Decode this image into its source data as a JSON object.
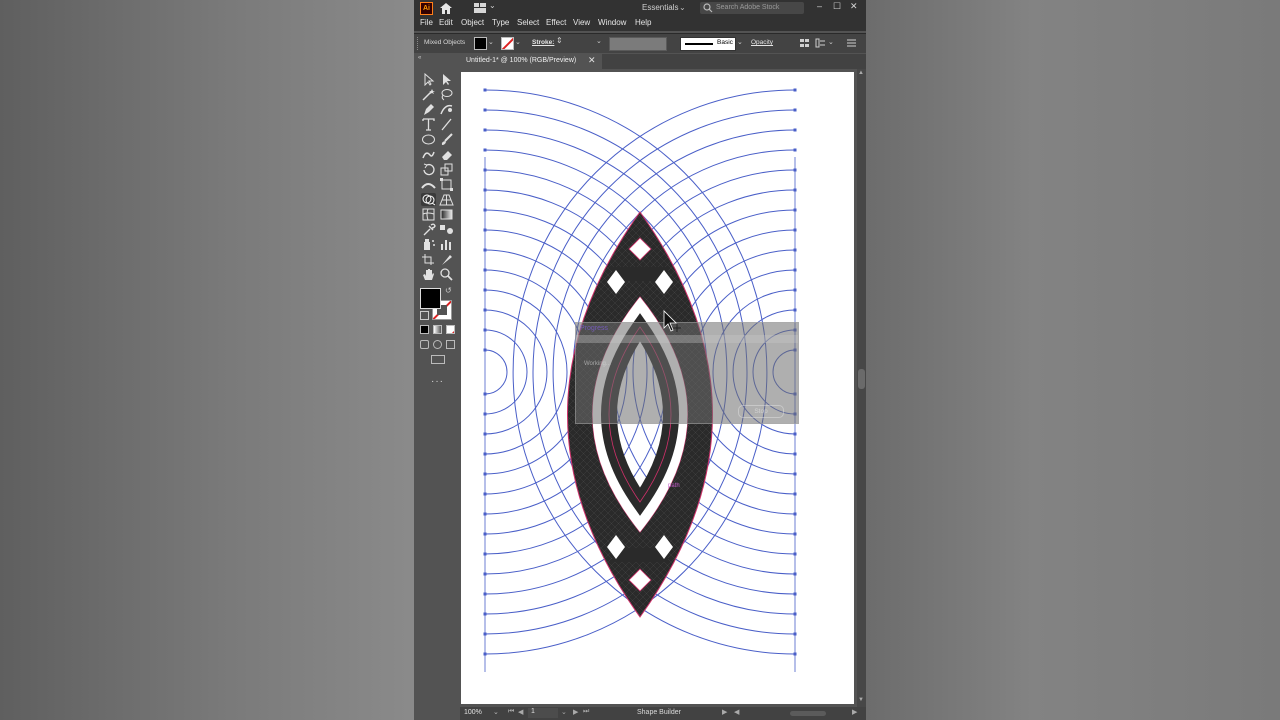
{
  "app": {
    "logo_text": "Ai",
    "workspace": "Essentials",
    "stock_search_placeholder": "Search Adobe Stock",
    "window_controls": [
      "–",
      "☐",
      "✕"
    ]
  },
  "menu": [
    "File",
    "Edit",
    "Object",
    "Type",
    "Select",
    "Effect",
    "View",
    "Window",
    "Help"
  ],
  "control_bar": {
    "selection_label": "Mixed Objects",
    "stroke_label": "Stroke:",
    "brush_label": "Basic",
    "opacity_label": "Opacity"
  },
  "document": {
    "tab_title": "Untitled-1* @ 100% (RGB/Preview)",
    "close_glyph": "✕"
  },
  "progress_dialog": {
    "title": "Progress",
    "message": "Working...",
    "stop_label": "Stop"
  },
  "canvas": {
    "hover_label": "path"
  },
  "status": {
    "zoom": "100%",
    "artboard": "1",
    "tool": "Shape Builder"
  },
  "colors": {
    "app_bg": "#535353",
    "chrome": "#323232",
    "artboard": "#ffffff",
    "path_blue": "#4a5fc8",
    "shape_fill": "#2a2a2a",
    "highlight_red": "#d0306a"
  }
}
